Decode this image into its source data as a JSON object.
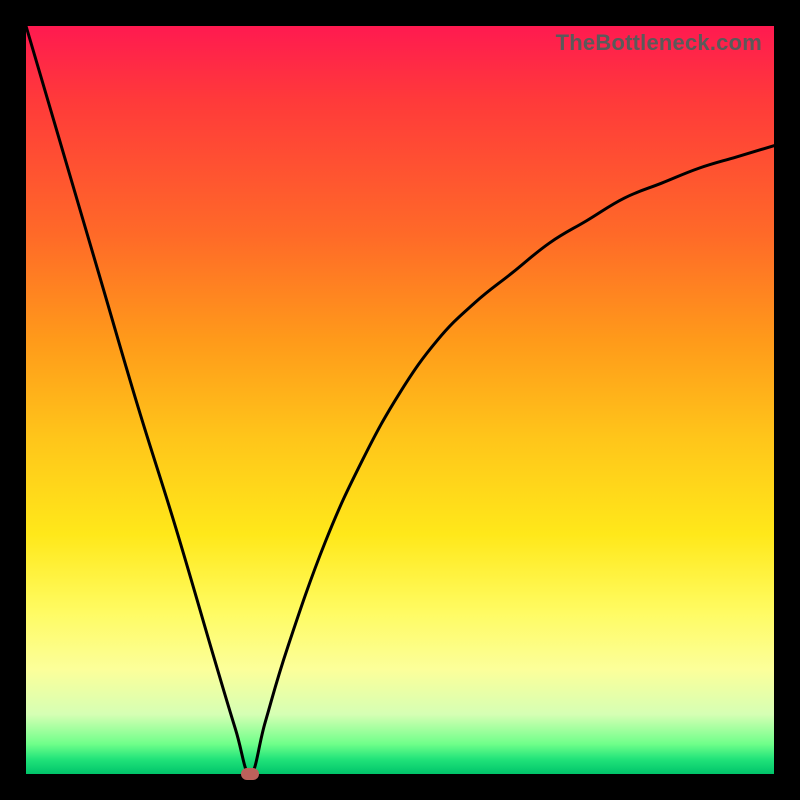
{
  "watermark": "TheBottleneck.com",
  "colors": {
    "frame": "#000000",
    "curve": "#000000",
    "marker": "#bd615b"
  },
  "chart_data": {
    "type": "line",
    "title": "",
    "xlabel": "",
    "ylabel": "",
    "xlim": [
      0,
      100
    ],
    "ylim": [
      0,
      100
    ],
    "minimum_marker": {
      "x": 30,
      "y": 0
    },
    "series": [
      {
        "name": "left-branch",
        "x": [
          0,
          5,
          10,
          15,
          20,
          25,
          28,
          30
        ],
        "values": [
          100,
          83,
          66,
          49,
          33,
          16,
          6,
          0
        ]
      },
      {
        "name": "right-branch",
        "x": [
          30,
          32,
          35,
          40,
          45,
          50,
          55,
          60,
          65,
          70,
          75,
          80,
          85,
          90,
          95,
          100
        ],
        "values": [
          0,
          7,
          17,
          31,
          42,
          51,
          58,
          63,
          67,
          71,
          74,
          77,
          79,
          81,
          82.5,
          84
        ]
      }
    ]
  }
}
